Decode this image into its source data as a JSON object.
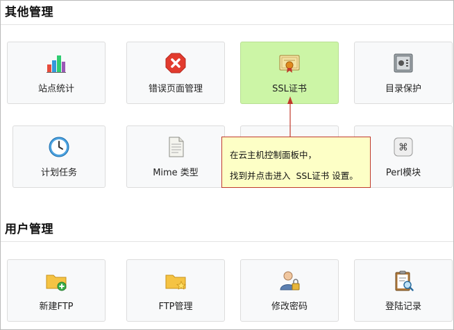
{
  "sections": [
    {
      "title": "其他管理"
    },
    {
      "title": "用户管理"
    }
  ],
  "tiles": {
    "site_stats": {
      "label": "站点统计",
      "icon": "bar-chart-icon"
    },
    "error_pages": {
      "label": "错误页面管理",
      "icon": "error-x-icon"
    },
    "ssl": {
      "label": "SSL证书",
      "icon": "certificate-icon"
    },
    "dir_protect": {
      "label": "目录保护",
      "icon": "safe-icon"
    },
    "scheduled": {
      "label": "计划任务",
      "icon": "clock-icon"
    },
    "mime": {
      "label": "Mime 类型",
      "icon": "document-icon"
    },
    "perl": {
      "label": "Perl模块",
      "icon": "command-key-icon"
    },
    "new_ftp": {
      "label": "新建FTP",
      "icon": "folder-add-icon"
    },
    "ftp_manage": {
      "label": "FTP管理",
      "icon": "folder-star-icon"
    },
    "change_pwd": {
      "label": "修改密码",
      "icon": "user-lock-icon"
    },
    "login_log": {
      "label": "登陆记录",
      "icon": "clipboard-search-icon"
    }
  },
  "callout": {
    "line1": "在云主机控制面板中，",
    "line2": "找到并点击进入  SSL证书 设置。"
  },
  "colors": {
    "active_tile": "#ccf5a6",
    "callout_bg": "#fdffc6",
    "callout_border": "#c0392b"
  }
}
